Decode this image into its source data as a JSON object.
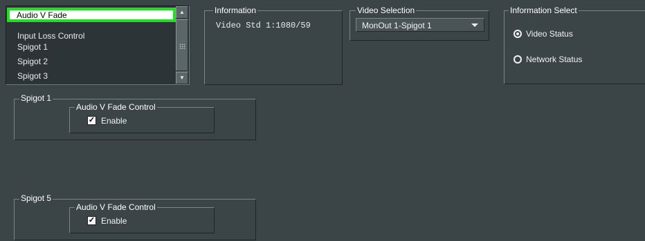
{
  "list": {
    "items": [
      "Audio V Fade",
      "Input Loss Control",
      "Spigot 1",
      "Spigot 2",
      "Spigot 3"
    ],
    "selected_index": 0
  },
  "information": {
    "title": "Information",
    "text": "Video Std 1:1080/59"
  },
  "video_selection": {
    "title": "Video Selection",
    "selected": "MonOut 1-Spigot 1"
  },
  "information_select": {
    "title": "Information Select",
    "options": [
      "Video Status",
      "Network Status"
    ],
    "selected_index": 0
  },
  "spigots": [
    {
      "title": "Spigot 1",
      "control_title": "Audio V Fade Control",
      "enable_label": "Enable",
      "enabled": true
    },
    {
      "title": "Spigot 5",
      "control_title": "Audio V Fade Control",
      "enable_label": "Enable",
      "enabled": true
    }
  ],
  "icons": {
    "scroll_up": "scroll-up-arrow-icon",
    "scroll_down": "scroll-down-arrow-icon",
    "dropdown": "chevron-down-icon",
    "check": "checkmark-icon"
  },
  "colors": {
    "background": "#3b4548",
    "selection_highlight": "#21e021"
  }
}
